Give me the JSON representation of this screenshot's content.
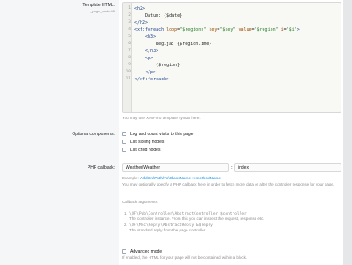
{
  "template": {
    "label": "Template HTML:",
    "sublabel": "_page_node.45",
    "lines": [
      {
        "n": "1",
        "html": "<span>&lt;h2&gt;</span>"
      },
      {
        "n": "2",
        "html": "<span class=\"plain\">    Datum: {$date}</span>"
      },
      {
        "n": "3",
        "html": "<span>&lt;/h2&gt;</span>"
      },
      {
        "n": "4",
        "html": "<span>&lt;xf:foreach </span><span class=\"attr\">loop</span><span class=\"plain\">=</span><span class=\"str\">\"$regions\"</span><span> </span><span class=\"attr\">key</span><span class=\"plain\">=</span><span class=\"str\">\"$key\"</span><span> </span><span class=\"attr\">value</span><span class=\"plain\">=</span><span class=\"str\">\"$region\"</span><span> </span><span class=\"attr\">i</span><span class=\"plain\">=</span><span class=\"str\">\"$i\"</span><span>&gt;</span>"
      },
      {
        "n": "5",
        "html": "<span>    &lt;h3&gt;</span>"
      },
      {
        "n": "6",
        "html": "<span class=\"plain\">        Regija: {$region.ime}</span>"
      },
      {
        "n": "7",
        "html": "<span>    &lt;/h3&gt;</span>"
      },
      {
        "n": "8",
        "html": "<span>    &lt;p&gt;</span>"
      },
      {
        "n": "9",
        "html": "<span class=\"plain\">        {$region}</span>"
      },
      {
        "n": "10",
        "html": "<span>    &lt;/p&gt;</span>"
      },
      {
        "n": "11",
        "html": "<span>&lt;/xf:foreach&gt;</span>"
      }
    ],
    "hint": "You may use XenForo template syntax here."
  },
  "optional": {
    "label": "Optional components:",
    "items": [
      "Log and count visits to this page",
      "List sibling nodes",
      "List child nodes"
    ]
  },
  "callback": {
    "label": "PHP callback:",
    "class_value": "Weather\\Weather",
    "separator": "::",
    "method_value": "index",
    "example_prefix": "Example: ",
    "example_bold": "AddOn\\Path\\To\\ClassName :: methodName",
    "description": "You may optionally specify a PHP callback here in order to fetch more data or alter the controller response for your page.",
    "args_title": "Callback arguments:",
    "args": [
      {
        "num": "1.",
        "code": "\\XF\\Pub\\Controller\\AbstractController $controller",
        "desc": "The controller instance. From this you can inspect the request, response etc."
      },
      {
        "num": "2.",
        "code": "\\XF\\Mvc\\Reply\\AbstractReply &$reply",
        "desc": "The standard reply from the page controller."
      }
    ]
  },
  "advanced": {
    "label": "Advanced mode",
    "desc": "If enabled, the HTML for your page will not be contained within a block."
  }
}
